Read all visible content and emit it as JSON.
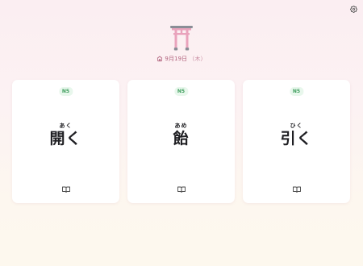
{
  "header": {
    "date": "9月19日",
    "weekday": "（木）",
    "logo_icon": "torii-gate-icon",
    "date_icon": "shrine-icon"
  },
  "settings": {
    "icon": "gear-icon"
  },
  "cards": [
    {
      "level": "N5",
      "reading": "あく",
      "kanji": "開く",
      "icon": "book-icon"
    },
    {
      "level": "N5",
      "reading": "あめ",
      "kanji": "飴",
      "icon": "book-icon"
    },
    {
      "level": "N5",
      "reading": "ひく",
      "kanji": "引く",
      "icon": "book-icon"
    }
  ],
  "colors": {
    "accent": "#b0607b",
    "badge_bg": "#e8f7ec",
    "badge_text": "#3f9e5e",
    "torii": "#e9a3bc"
  }
}
